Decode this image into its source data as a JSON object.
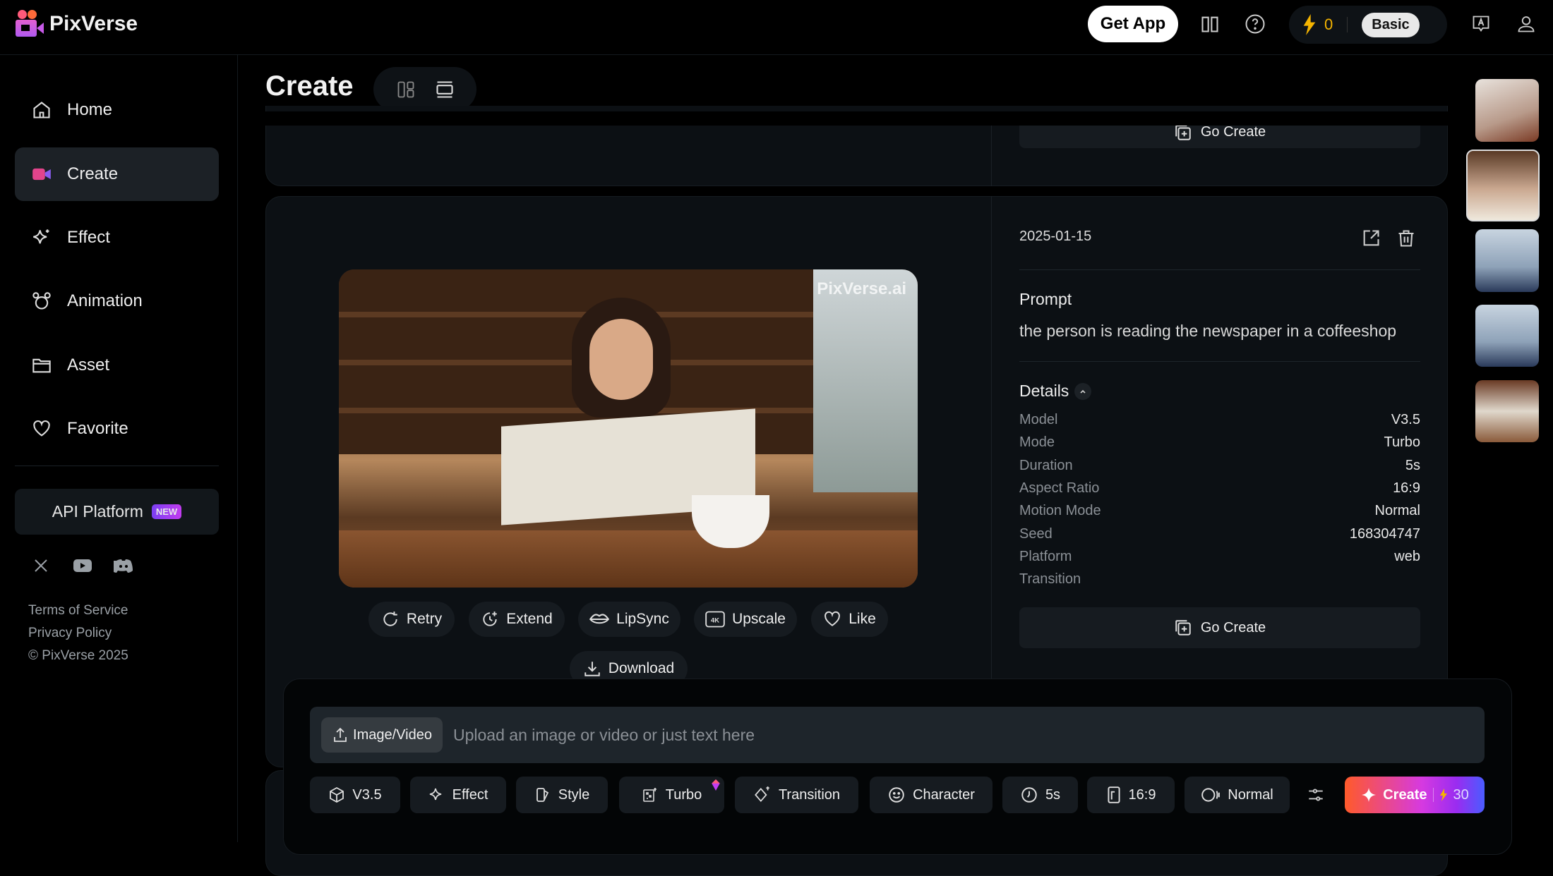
{
  "header": {
    "brand": "PixVerse",
    "get_app": "Get App",
    "credits": "0",
    "plan": "Basic"
  },
  "sidebar": {
    "items": [
      {
        "label": "Home",
        "icon": "home-icon"
      },
      {
        "label": "Create",
        "icon": "create-icon",
        "active": true
      },
      {
        "label": "Effect",
        "icon": "sparkle-icon"
      },
      {
        "label": "Animation",
        "icon": "animation-icon"
      },
      {
        "label": "Asset",
        "icon": "folder-icon"
      },
      {
        "label": "Favorite",
        "icon": "heart-icon"
      }
    ],
    "api_platform": "API Platform",
    "api_badge": "NEW",
    "terms": "Terms of Service",
    "privacy": "Privacy Policy",
    "copyright": "© PixVerse 2025"
  },
  "main": {
    "title": "Create",
    "prev_card": {
      "go_create": "Go Create"
    },
    "card": {
      "date": "2025-01-15",
      "watermark": "PixVerse.ai",
      "prompt_label": "Prompt",
      "prompt": "the person is reading the newspaper in a coffeeshop",
      "details_label": "Details",
      "details": [
        {
          "k": "Model",
          "v": "V3.5"
        },
        {
          "k": "Mode",
          "v": "Turbo"
        },
        {
          "k": "Duration",
          "v": "5s"
        },
        {
          "k": "Aspect Ratio",
          "v": "16:9"
        },
        {
          "k": "Motion Mode",
          "v": "Normal"
        },
        {
          "k": "Seed",
          "v": "168304747"
        },
        {
          "k": "Platform",
          "v": "web"
        },
        {
          "k": "Transition",
          "v": ""
        }
      ],
      "go_create": "Go Create",
      "actions": {
        "retry": "Retry",
        "extend": "Extend",
        "lipsync": "LipSync",
        "upscale": "Upscale",
        "like": "Like",
        "download": "Download"
      }
    }
  },
  "prompt_bar": {
    "upload": "Image/Video",
    "placeholder": "Upload an image or video or just text here",
    "tools": {
      "model": "V3.5",
      "effect": "Effect",
      "style": "Style",
      "turbo": "Turbo",
      "transition": "Transition",
      "character": "Character",
      "duration": "5s",
      "ratio": "16:9",
      "motion": "Normal"
    },
    "create": "Create",
    "cost": "30"
  },
  "colors": {
    "accent": "#f5b400",
    "create_gradient_start": "#ff5a2a",
    "create_gradient_end": "#4a5cff"
  }
}
